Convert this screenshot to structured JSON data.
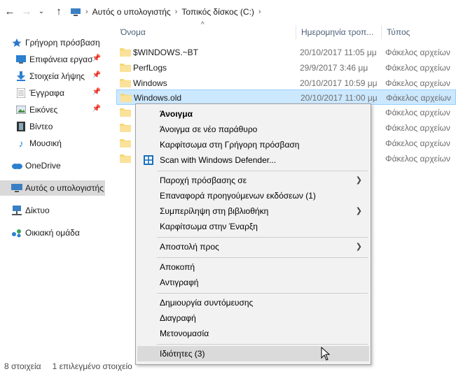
{
  "address_bar": {
    "back_icon": "back-arrow-icon",
    "forward_icon": "forward-arrow-icon",
    "up_icon": "up-arrow-icon",
    "breadcrumbs": [
      "Αυτός ο υπολογιστής",
      "Τοπικός δίσκος (C:)"
    ]
  },
  "nav": {
    "items": [
      {
        "label": "Γρήγορη πρόσβαση",
        "icon": "star-icon",
        "pinned": false
      },
      {
        "label": "Επιφάνεια εργασ",
        "icon": "desktop-icon",
        "pinned": true
      },
      {
        "label": "Στοιχεία λήψης",
        "icon": "download-icon",
        "pinned": true
      },
      {
        "label": "Έγγραφα",
        "icon": "documents-icon",
        "pinned": true
      },
      {
        "label": "Εικόνες",
        "icon": "pictures-icon",
        "pinned": true
      },
      {
        "label": "Βίντεο",
        "icon": "video-icon",
        "pinned": false
      },
      {
        "label": "Μουσική",
        "icon": "music-icon",
        "pinned": false
      },
      {
        "label": "OneDrive",
        "icon": "onedrive-icon",
        "pinned": false
      },
      {
        "label": "Αυτός ο υπολογιστής",
        "icon": "computer-icon",
        "pinned": false
      },
      {
        "label": "Δίκτυο",
        "icon": "network-icon",
        "pinned": false
      },
      {
        "label": "Οικιακή ομάδα",
        "icon": "homegroup-icon",
        "pinned": false
      }
    ]
  },
  "columns": {
    "name": "Όνομα",
    "date": "Ημερομηνία τροπ...",
    "type": "Τύπος"
  },
  "files": [
    {
      "name": "$WINDOWS.~BT",
      "date": "20/10/2017 11:05 μμ",
      "type": "Φάκελος αρχείων"
    },
    {
      "name": "PerfLogs",
      "date": "29/9/2017 3:46 μμ",
      "type": "Φάκελος αρχείων"
    },
    {
      "name": "Windows",
      "date": "20/10/2017 10:59 μμ",
      "type": "Φάκελος αρχείων"
    },
    {
      "name": "Windows.old",
      "date": "20/10/2017 11:00 μμ",
      "type": "Φάκελος αρχείων"
    },
    {
      "name": "",
      "date": "",
      "type": "Φάκελος αρχείων"
    },
    {
      "name": "",
      "date": "",
      "type": "Φάκελος αρχείων"
    },
    {
      "name": "",
      "date": "",
      "type": "Φάκελος αρχείων"
    },
    {
      "name": "",
      "date": "",
      "type": "Φάκελος αρχείων"
    }
  ],
  "context_menu": {
    "open": "Άνοιγμα",
    "open_new_window": "Άνοιγμα σε νέο παράθυρο",
    "pin_quick_access": "Καρφίτσωμα στη Γρήγορη πρόσβαση",
    "scan_defender": "Scan with Windows Defender...",
    "give_access": "Παροχή πρόσβασης σε",
    "restore_previous": "Επαναφορά προηγούμενων εκδόσεων (1)",
    "include_library": "Συμπερίληψη στη βιβλιοθήκη",
    "pin_start": "Καρφίτσωμα στην Έναρξη",
    "send_to": "Αποστολή προς",
    "cut": "Αποκοπή",
    "copy": "Αντιγραφή",
    "create_shortcut": "Δημιουργία συντόμευσης",
    "delete": "Διαγραφή",
    "rename": "Μετονομασία",
    "properties": "Ιδιότητες (3)"
  },
  "status": {
    "item_count": "8 στοιχεία",
    "selected": "1 επιλεγμένο στοιχείο"
  },
  "colors": {
    "selection_bg": "#cce8ff",
    "selection_border": "#99d1ff",
    "folder_yellow": "#f8d775",
    "menu_bg": "#f2f2f2",
    "menu_hover": "#dadada"
  }
}
